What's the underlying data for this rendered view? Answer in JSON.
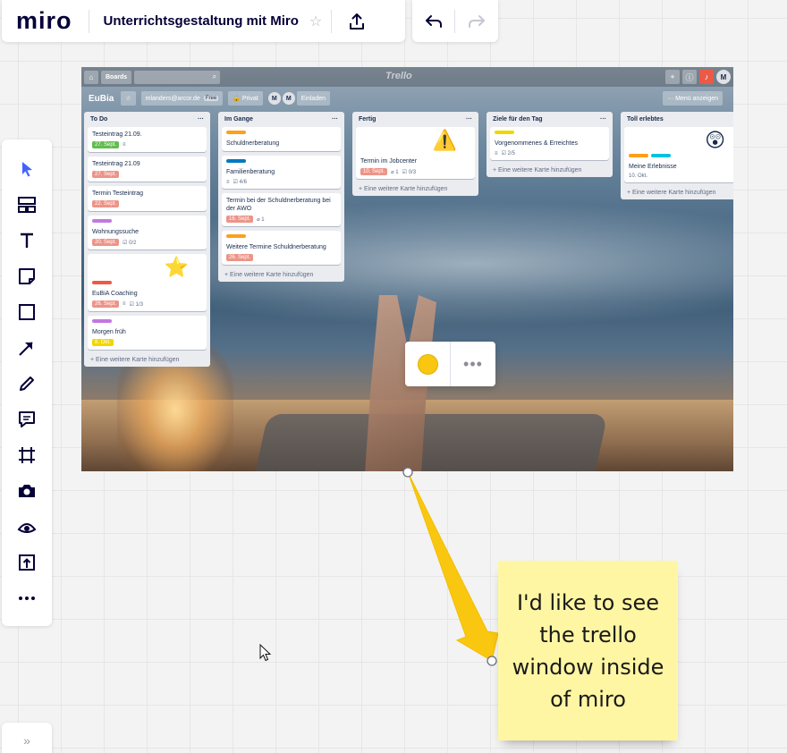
{
  "app": {
    "logo": "miro",
    "board_title": "Unterrichtsgestaltung mit Miro",
    "favorite_icon": "star-outline-icon",
    "share_icon": "upload-icon",
    "undo_icon": "undo-icon",
    "redo_icon": "redo-icon"
  },
  "toolbar": {
    "tools": [
      {
        "name": "select",
        "icon": "cursor-arrow-icon"
      },
      {
        "name": "templates",
        "icon": "templates-icon"
      },
      {
        "name": "text",
        "icon": "text-icon"
      },
      {
        "name": "sticky-note",
        "icon": "sticky-note-icon"
      },
      {
        "name": "shape",
        "icon": "square-icon"
      },
      {
        "name": "connection-line",
        "icon": "arrow-line-icon"
      },
      {
        "name": "pen",
        "icon": "pen-icon"
      },
      {
        "name": "comment",
        "icon": "comment-icon"
      },
      {
        "name": "frame",
        "icon": "frame-icon"
      },
      {
        "name": "capture",
        "icon": "camera-icon"
      },
      {
        "name": "emoji",
        "icon": "eye-icon"
      },
      {
        "name": "upload",
        "icon": "upload-icon"
      },
      {
        "name": "more",
        "icon": "more-dots-icon"
      }
    ],
    "expand_label": "»"
  },
  "trello": {
    "topbar": {
      "boards_label": "Boards",
      "logo": "Trello",
      "avatar": "M",
      "search_icon": "search-icon",
      "home_icon": "home-icon"
    },
    "header": {
      "board_name": "EuBia",
      "email": "mlanders@arcor.de",
      "plan": "Free",
      "visibility": "Privat",
      "members": [
        "M",
        "M"
      ],
      "invite_label": "Einladen",
      "menu_label": "Menü anzeigen"
    },
    "add_card_label": "+ Eine weitere Karte hinzufügen",
    "lists": [
      {
        "title": "To Do",
        "cards": [
          {
            "title": "Testeintrag 21.09.",
            "labels": [],
            "badge": {
              "text": "27. Sept.",
              "color": "green"
            },
            "extra": [
              "≡"
            ]
          },
          {
            "title": "Testeintrag 21.09",
            "labels": [],
            "badge": {
              "text": "27. Sept.",
              "color": "red"
            },
            "extra": []
          },
          {
            "title": "Termin Testeintrag",
            "labels": [],
            "badge": {
              "text": "22. Sept.",
              "color": "red"
            },
            "extra": []
          },
          {
            "title": "Wohnungssuche",
            "labels": [
              "#c377e0"
            ],
            "badge": {
              "text": "20. Sept.",
              "color": "red"
            },
            "extra": [
              "☑ 0/2"
            ]
          },
          {
            "title": "EuBiA Coaching",
            "labels": [
              "#eb5a46"
            ],
            "badge": {
              "text": "26. Sept.",
              "color": "red"
            },
            "extra": [
              "≡",
              "☑ 1/3"
            ],
            "sticker": "⭐"
          },
          {
            "title": "Morgen früh",
            "labels": [
              "#c377e0"
            ],
            "badge": {
              "text": "8. Okt.",
              "color": "yellow"
            },
            "extra": []
          }
        ]
      },
      {
        "title": "Im Gange",
        "cards": [
          {
            "title": "Schuldnerberatung",
            "labels": [
              "#ff9f1a"
            ],
            "badge": null,
            "extra": []
          },
          {
            "title": "Familienberatung",
            "labels": [
              "#0079bf"
            ],
            "badge": null,
            "extra": [
              "≡",
              "☑ 4/6"
            ]
          },
          {
            "title": "Termin bei der Schuldnerberatung bei der AWO",
            "labels": [],
            "badge": {
              "text": "16. Sept.",
              "color": "red"
            },
            "extra": [
              "⌀ 1"
            ]
          },
          {
            "title": "Weitere Termine Schuldnerberatung",
            "labels": [
              "#ff9f1a"
            ],
            "badge": {
              "text": "26. Sept.",
              "color": "red"
            },
            "extra": []
          }
        ]
      },
      {
        "title": "Fertig",
        "cards": [
          {
            "title": "Termin im Jobcenter",
            "labels": [],
            "badge": {
              "text": "10. Sept.",
              "color": "red"
            },
            "extra": [
              "⌀ 1",
              "☑ 0/3"
            ],
            "sticker": "⚠️"
          }
        ]
      },
      {
        "title": "Ziele für den Tag",
        "cards": [
          {
            "title": "Vorgenommenes & Erreichtes",
            "labels": [
              "#f2d600"
            ],
            "badge": null,
            "extra": [
              "≡",
              "☑ 2/5"
            ]
          }
        ]
      },
      {
        "title": "Toll erlebtes",
        "cards": [
          {
            "title": "Meine Erlebnisse",
            "labels": [
              "#ff9f1a",
              "#00c2e0"
            ],
            "badge": {
              "text": "10. Okt.",
              "color": "plain"
            },
            "extra": [],
            "sticker": "😲"
          }
        ]
      }
    ]
  },
  "palette": {
    "color": "#fac710",
    "more_label": "•••"
  },
  "sticky": {
    "text": "I'd like to see the trello window inside of miro",
    "color": "#fff6a3"
  },
  "connector": {
    "color": "#fac710"
  }
}
